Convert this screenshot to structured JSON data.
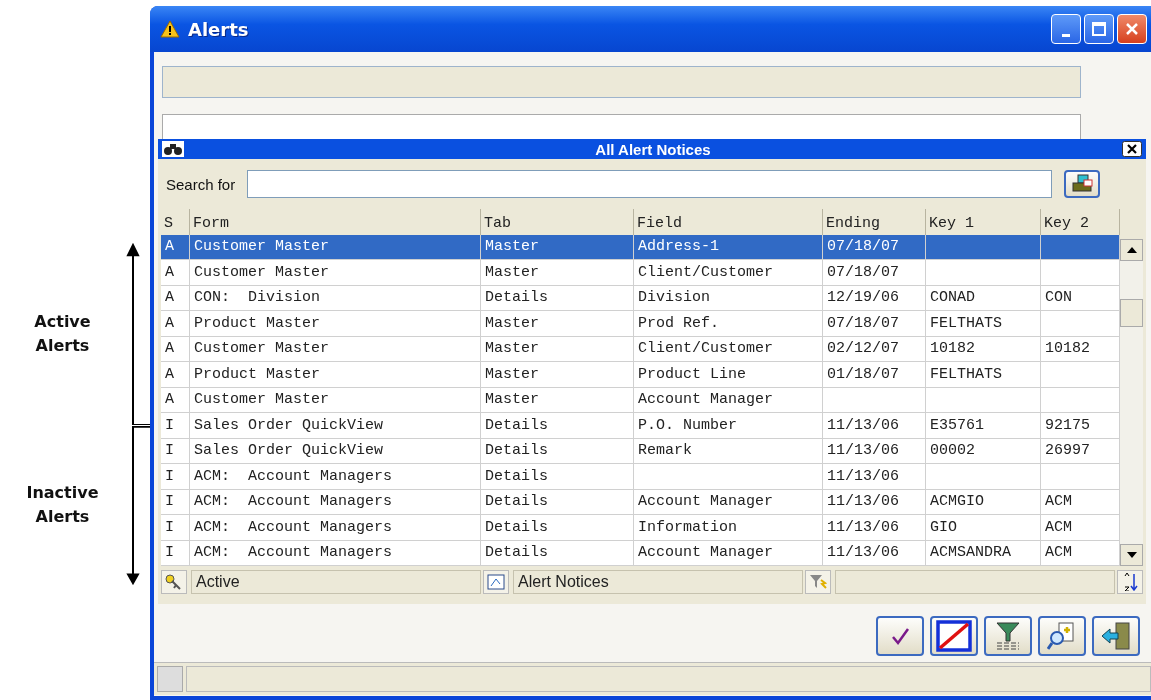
{
  "window": {
    "title": "Alerts"
  },
  "annotations": [
    {
      "label": "Active Alerts",
      "kind": "up"
    },
    {
      "label": "Inactive Alerts",
      "kind": "down"
    }
  ],
  "notices": {
    "title": "All  Alert Notices",
    "search": {
      "label": "Search for"
    },
    "columns": [
      "S",
      "Form",
      "Tab",
      "Field",
      "Ending",
      "Key 1",
      "Key 2"
    ],
    "rows": [
      {
        "selected": true,
        "status": "A",
        "form": "Customer Master",
        "tab": "Master",
        "field": "Address-1",
        "ending": "07/18/07"
      },
      {
        "selected": false,
        "status": "A",
        "form": "Customer Master",
        "tab": "Master",
        "field": "Client/Customer",
        "ending": "07/18/07"
      },
      {
        "selected": false,
        "status": "A",
        "form": "CON:  Division",
        "tab": "Details",
        "field": "Division",
        "ending": "12/19/06",
        "key_1": "CONAD",
        "key_2": "CON"
      },
      {
        "selected": false,
        "status": "A",
        "form": "Product Master",
        "tab": "Master",
        "field": "Prod Ref.",
        "ending": "07/18/07",
        "key_1": "FELTHATS"
      },
      {
        "selected": false,
        "status": "A",
        "form": "Customer Master",
        "tab": "Master",
        "field": "Client/Customer",
        "ending": "02/12/07",
        "key_1": "10182",
        "key_2": "10182"
      },
      {
        "selected": false,
        "status": "A",
        "form": "Product Master",
        "tab": "Master",
        "field": "Product Line",
        "ending": "01/18/07",
        "key_1": "FELTHATS"
      },
      {
        "selected": false,
        "status": "A",
        "form": "Customer Master",
        "tab": "Master",
        "field": "Account Manager"
      },
      {
        "selected": false,
        "status": "I",
        "form": "Sales Order QuickView",
        "tab": "Details",
        "field": "P.O. Number",
        "ending": "11/13/06",
        "key_1": "E35761",
        "key_2": "92175"
      },
      {
        "selected": false,
        "status": "I",
        "form": "Sales Order QuickView",
        "tab": "Details",
        "field": "Remark",
        "ending": "11/13/06",
        "key_1": "00002",
        "key_2": "26997"
      },
      {
        "selected": false,
        "status": "I",
        "form": "ACM:  Account Managers",
        "tab": "Details",
        "ending": "11/13/06"
      },
      {
        "selected": false,
        "status": "I",
        "form": "ACM:  Account Managers",
        "tab": "Details",
        "field": "Account Manager",
        "ending": "11/13/06",
        "key_1": "ACMGIO",
        "key_2": "ACM"
      },
      {
        "selected": false,
        "status": "I",
        "form": "ACM:  Account Managers",
        "tab": "Details",
        "field": "Information",
        "ending": "11/13/06",
        "key_1": "GIO",
        "key_2": "ACM"
      },
      {
        "selected": false,
        "status": "I",
        "form": "ACM:  Account Managers",
        "tab": "Details",
        "field": "Account Manager",
        "ending": "11/13/06",
        "key_1": "ACMSANDRA",
        "key_2": "ACM"
      }
    ],
    "status_bar": [
      {
        "kind": "filter",
        "label": "Active"
      },
      {
        "kind": "view",
        "label": "Alert Notices"
      },
      {
        "kind": "query"
      }
    ]
  }
}
